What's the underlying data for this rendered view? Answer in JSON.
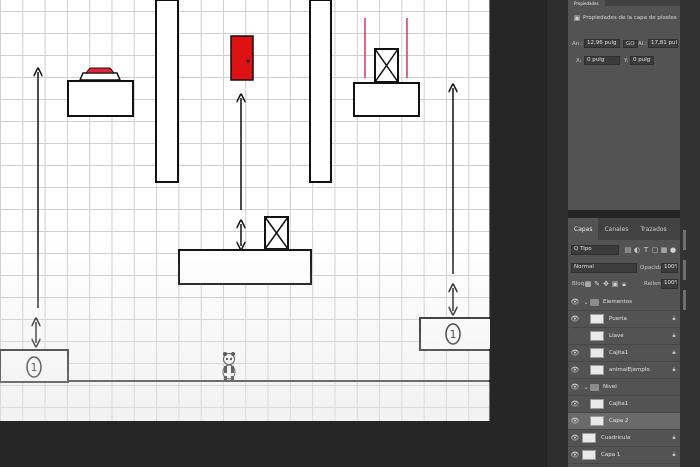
{
  "canvas": {
    "door_color": "#dd1111",
    "button_color": "#e2263a",
    "guide_color": "#d8336b",
    "labels": {
      "platform_left_number": "1",
      "platform_right_number": "1"
    }
  },
  "properties_panel": {
    "tab_label": "Propiedades",
    "heading": "Propiedades de la capa de píxeles",
    "an_label": "An.:",
    "an_value": "12,96 pulg",
    "go_label": "GO",
    "al_label": "Al.:",
    "al_value": "17,81 pulg",
    "x_label": "X:",
    "x_value": "0 pulg",
    "y_label": "Y:",
    "y_value": "0 pulg"
  },
  "layers_panel": {
    "tabs": [
      "Capas",
      "Canales",
      "Trazados"
    ],
    "filter_label": "Q Tipo",
    "blend_mode": "Normal",
    "opacity_label": "Opacidad:",
    "opacity_value": "100%",
    "lock_label": "Bloq.:",
    "fill_label": "Relleno:",
    "fill_value": "100%",
    "layers": [
      {
        "name": "Elementos",
        "kind": "group",
        "indent": 0
      },
      {
        "name": "Puerta",
        "kind": "layer",
        "indent": 1
      },
      {
        "name": "Llave",
        "kind": "layer",
        "indent": 1
      },
      {
        "name": "Cajita1",
        "kind": "layer",
        "indent": 1
      },
      {
        "name": "animalEjemplo",
        "kind": "layer",
        "indent": 1
      },
      {
        "name": "Nivel",
        "kind": "group",
        "indent": 0
      },
      {
        "name": "Cajita1",
        "kind": "layer",
        "indent": 1
      },
      {
        "name": "Capa 2",
        "kind": "layer",
        "indent": 1,
        "selected": true
      },
      {
        "name": "Cuadricula",
        "kind": "layer",
        "indent": 0
      },
      {
        "name": "Capa 1",
        "kind": "layer",
        "indent": 0
      }
    ]
  }
}
